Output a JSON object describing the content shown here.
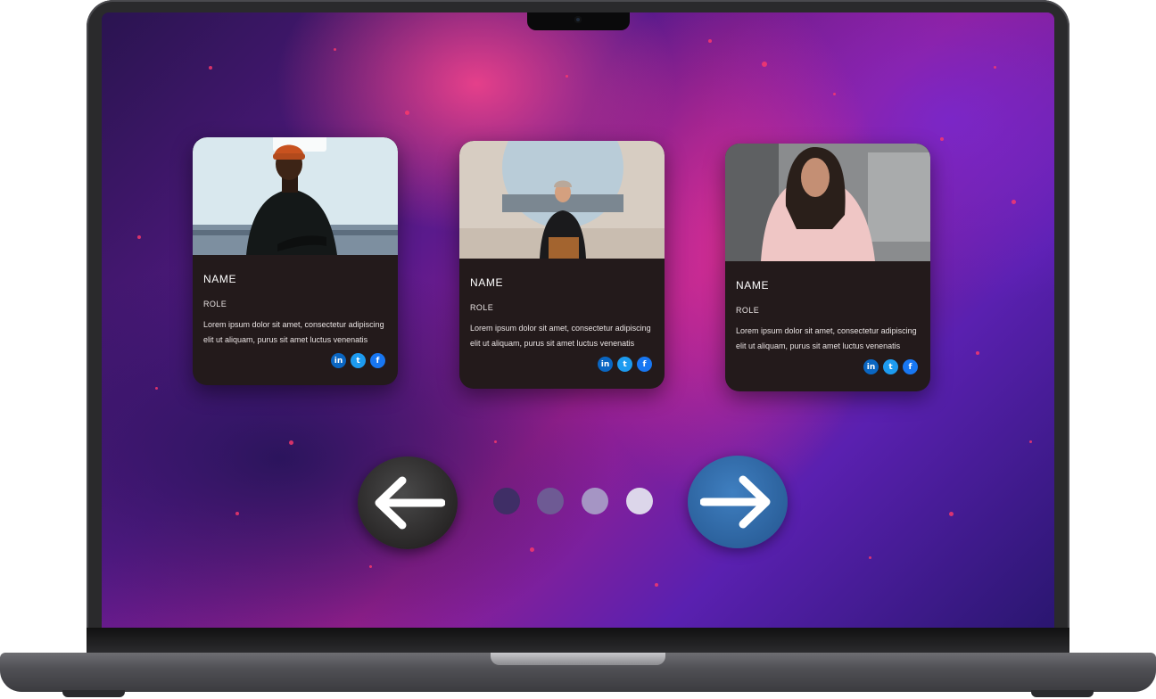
{
  "cards": [
    {
      "name": "NAME",
      "role": "ROLE",
      "description": "Lorem ipsum dolor sit amet, consectetur adipiscing elit ut aliquam, purus sit amet luctus venenatis",
      "socials": [
        "in",
        "t",
        "f"
      ]
    },
    {
      "name": "NAME",
      "role": "ROLE",
      "description": "Lorem ipsum dolor sit amet, consectetur adipiscing elit ut aliquam, purus sit amet luctus venenatis",
      "socials": [
        "in",
        "t",
        "f"
      ]
    },
    {
      "name": "NAME",
      "role": "ROLE",
      "description": "Lorem ipsum dolor sit amet, consectetur adipiscing elit ut aliquam, purus sit amet luctus venenatis",
      "socials": [
        "in",
        "t",
        "f"
      ]
    }
  ],
  "navigation": {
    "prev_icon": "arrow-left-icon",
    "next_icon": "arrow-right-icon",
    "pagination_count": 4,
    "active_index": 3
  },
  "colors": {
    "card_bg": "#231a1b",
    "next_button": "#2a5f9a",
    "prev_button": "#2e2c2c",
    "linkedin": "#0a66c2",
    "twitter": "#1d9bf0",
    "facebook": "#1877f2"
  }
}
